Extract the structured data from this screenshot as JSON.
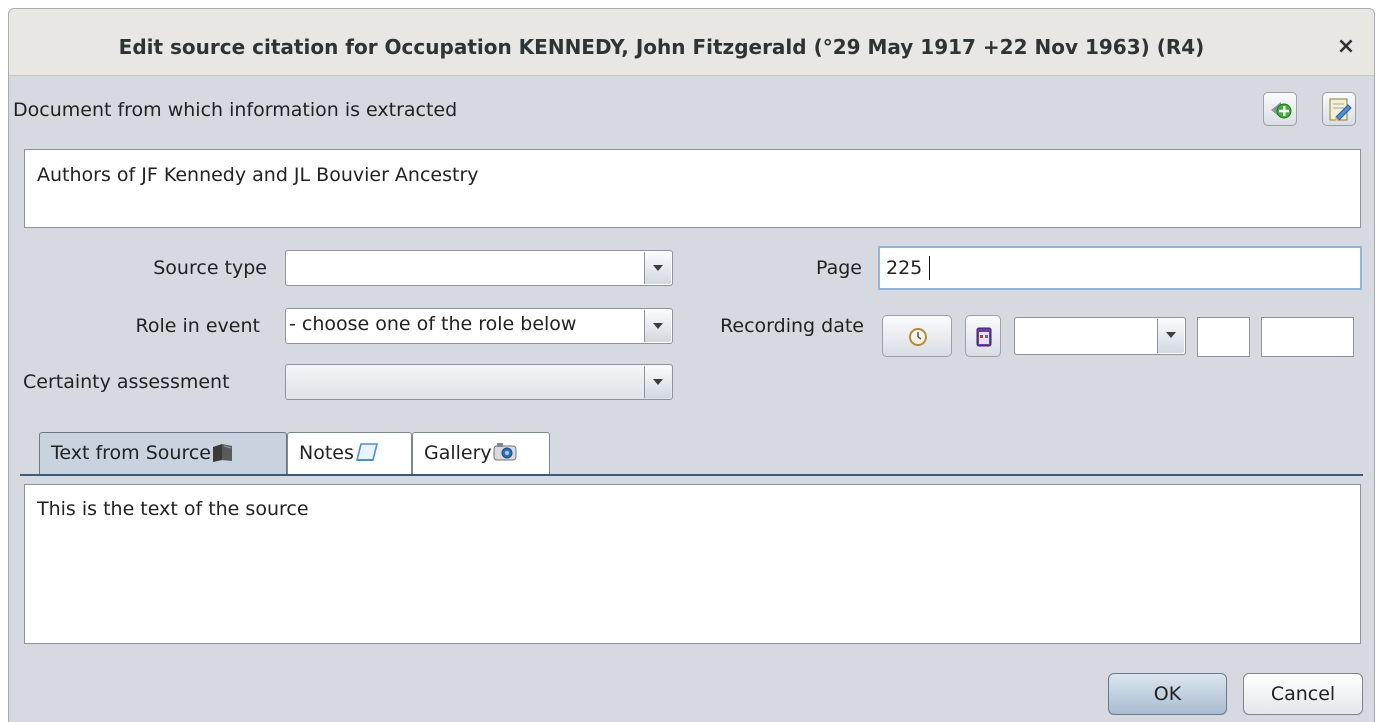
{
  "window": {
    "title": "Edit source citation  for Occupation KENNEDY, John Fitzgerald (°29 May 1917 +22 Nov 1963) (R4)",
    "close_label": "×"
  },
  "source": {
    "label": "Document from which information is extracted",
    "value": "Authors of JF Kennedy and JL Bouvier Ancestry",
    "add_icon": "add-source-icon",
    "edit_icon": "edit-source-icon"
  },
  "fields": {
    "source_type_label": "Source type",
    "source_type_value": "",
    "role_label": "Role in event",
    "role_value": "- choose one of the role below",
    "certainty_label": "Certainty assessment",
    "certainty_value": "",
    "page_label": "Page",
    "page_value": "225",
    "recording_date_label": "Recording date",
    "recording_date_month": "",
    "recording_date_day": "",
    "recording_date_year": ""
  },
  "tabs": [
    {
      "label": "Text from Source",
      "icon": "book-icon",
      "active": true
    },
    {
      "label": "Notes",
      "icon": "note-icon",
      "active": false
    },
    {
      "label": "Gallery",
      "icon": "camera-icon",
      "active": false
    }
  ],
  "text_area": {
    "value": "This is the text of the source"
  },
  "buttons": {
    "ok": "OK",
    "cancel": "Cancel"
  },
  "colors": {
    "dialog_bg": "#d6d9df",
    "active_tab": "#c8d3df",
    "ok_button": "#a9bccf"
  }
}
